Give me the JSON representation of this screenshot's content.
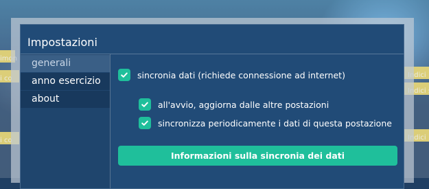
{
  "background_app": {
    "bars_text": [
      "imon",
      "i co",
      "Indici",
      "Indici s",
      "i co",
      "Indici"
    ]
  },
  "modal": {
    "title": "Impostazioni",
    "sidebar": {
      "items": [
        {
          "label": "generali",
          "active": true
        },
        {
          "label": "anno esercizio",
          "active": false
        },
        {
          "label": "about",
          "active": false
        }
      ]
    },
    "content": {
      "options": [
        {
          "label": "sincronia dati (richiede connessione ad internet)",
          "checked": true
        },
        {
          "label": "all'avvio, aggiorna dalle altre postazioni",
          "checked": true
        },
        {
          "label": "sincronizza periodicamente i dati di questa postazione",
          "checked": true
        }
      ],
      "info_button_label": "Informazioni sulla sincronia dei dati"
    }
  },
  "colors": {
    "accent": "#1fbf9b",
    "modal_bg": "#214b77",
    "sidebar_bg": "#1f456d",
    "sidebar_item_bg": "#18395d",
    "sidebar_active_bg": "#3a5f86",
    "highlight_bar": "#e9d25b"
  },
  "icons": {
    "checkbox_check": "check-icon"
  }
}
